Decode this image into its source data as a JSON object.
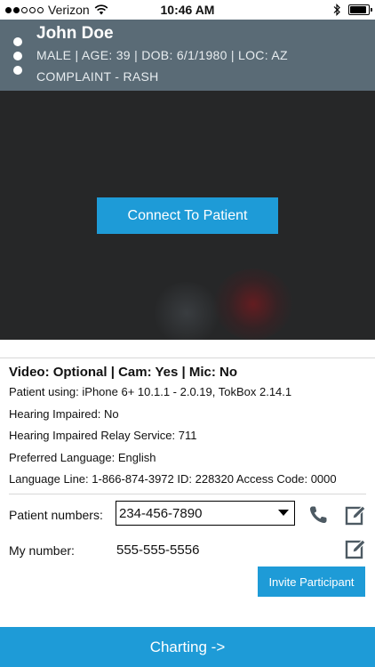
{
  "status_bar": {
    "carrier": "Verizon",
    "time": "10:46 AM",
    "signal_bars_filled": 2,
    "signal_bars_total": 5,
    "battery_level": 0.9
  },
  "patient": {
    "name": "John Doe",
    "meta": "MALE | AGE: 39 | DOB: 6/1/1980 | LOC: AZ",
    "complaint": "COMPLAINT - RASH"
  },
  "video": {
    "connect_label": "Connect To Patient"
  },
  "info": {
    "title": "Video: Optional | Cam: Yes | Mic: No",
    "lines": [
      "Patient using: iPhone 6+ 10.1.1 - 2.0.19, TokBox 2.14.1",
      "Hearing Impaired: No",
      "Hearing Impaired Relay Service: 711",
      "Preferred Language: English",
      "Language Line: 1-866-874-3972 ID: 228320 Access Code: 0000"
    ]
  },
  "numbers": {
    "patient_label": "Patient numbers:",
    "patient_selected": "234-456-7890",
    "my_label": "My number:",
    "my_value": "555-555-5556"
  },
  "invite_label": "Invite Participant",
  "charting_label": "Charting ->",
  "colors": {
    "accent": "#1e9bd7",
    "header_bg": "#5a6b76",
    "video_bg": "#262728"
  }
}
